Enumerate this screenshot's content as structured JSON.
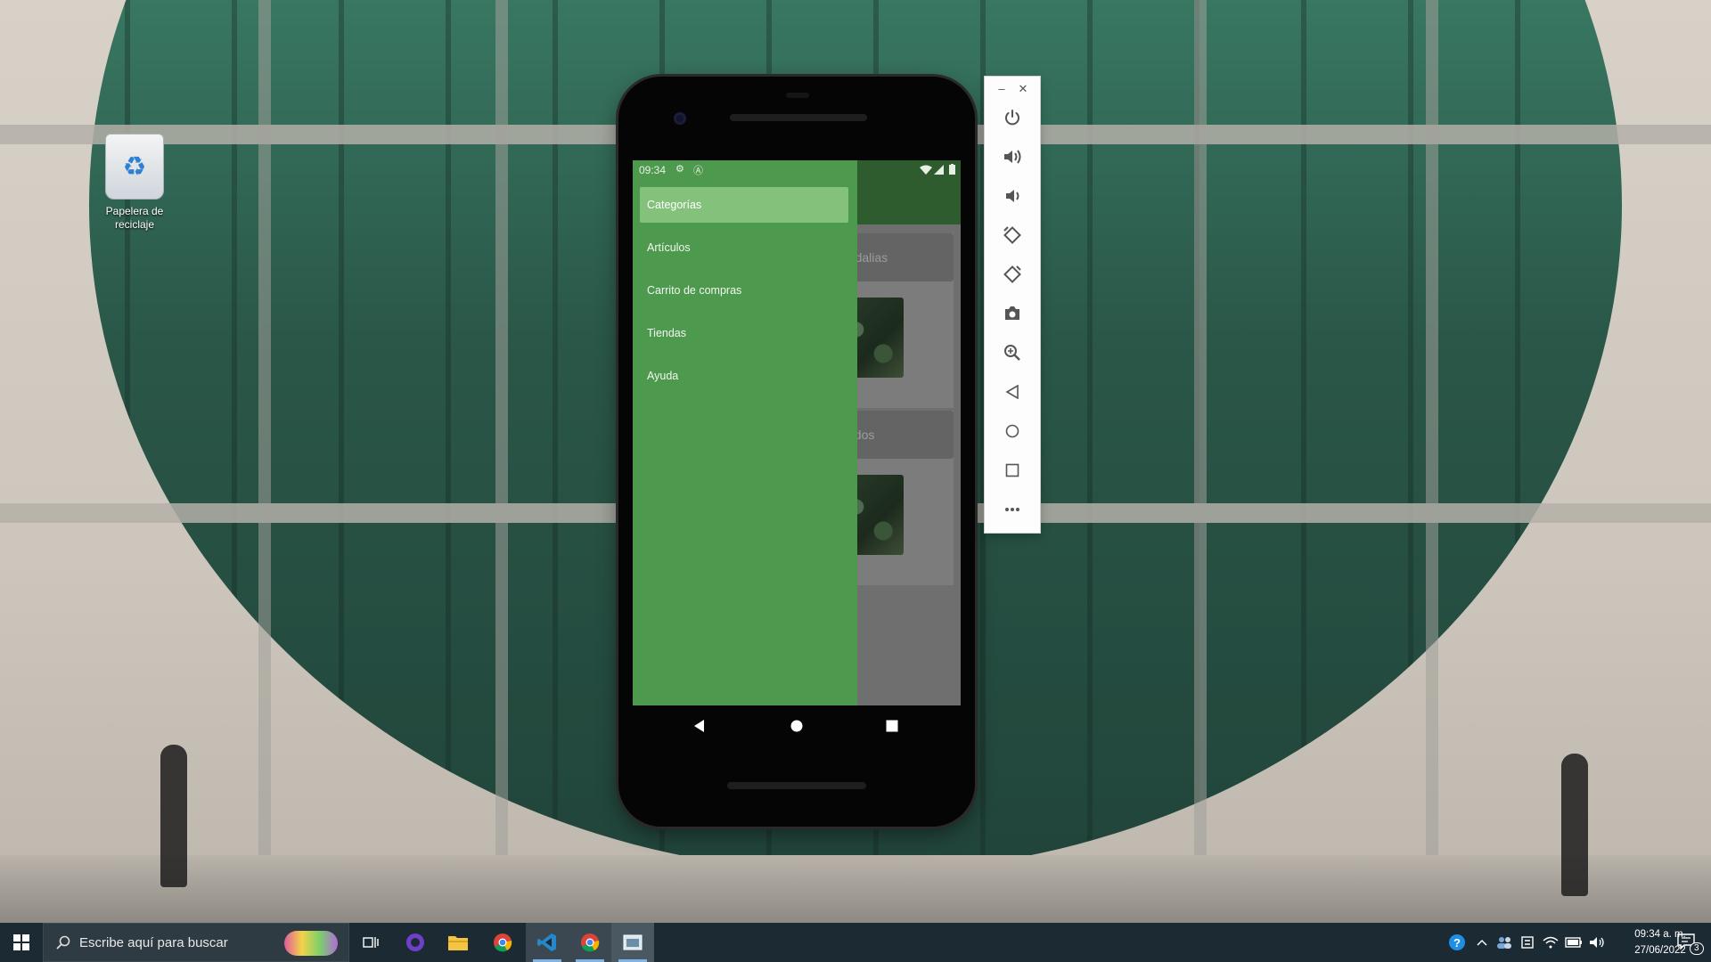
{
  "desktop": {
    "recycle_bin_label": "Papelera de reciclaje"
  },
  "emulator": {
    "status_time": "09:34",
    "drawer": {
      "items": [
        {
          "label": "Categorías",
          "active": true
        },
        {
          "label": "Artículos",
          "active": false
        },
        {
          "label": "Carrito de compras",
          "active": false
        },
        {
          "label": "Tiendas",
          "active": false
        },
        {
          "label": "Ayuda",
          "active": false
        }
      ]
    },
    "background_cards": [
      {
        "label": "andalias"
      },
      {
        "label": "Todos"
      }
    ],
    "toolbar_icons": [
      "power-icon",
      "volume-up-icon",
      "volume-down-icon",
      "rotate-left-icon",
      "rotate-right-icon",
      "camera-icon",
      "zoom-icon",
      "back-icon",
      "home-icon",
      "overview-icon",
      "more-icon"
    ]
  },
  "taskbar": {
    "search_placeholder": "Escribe aquí para buscar",
    "clock_time": "09:34 a. m.",
    "clock_date": "27/06/2022",
    "notification_count": "3"
  },
  "colors": {
    "drawer": "#4d9a4f",
    "drawer_active": "#84c27c",
    "appbar": "#2e5c2e",
    "taskbar": "#1c2a34"
  }
}
